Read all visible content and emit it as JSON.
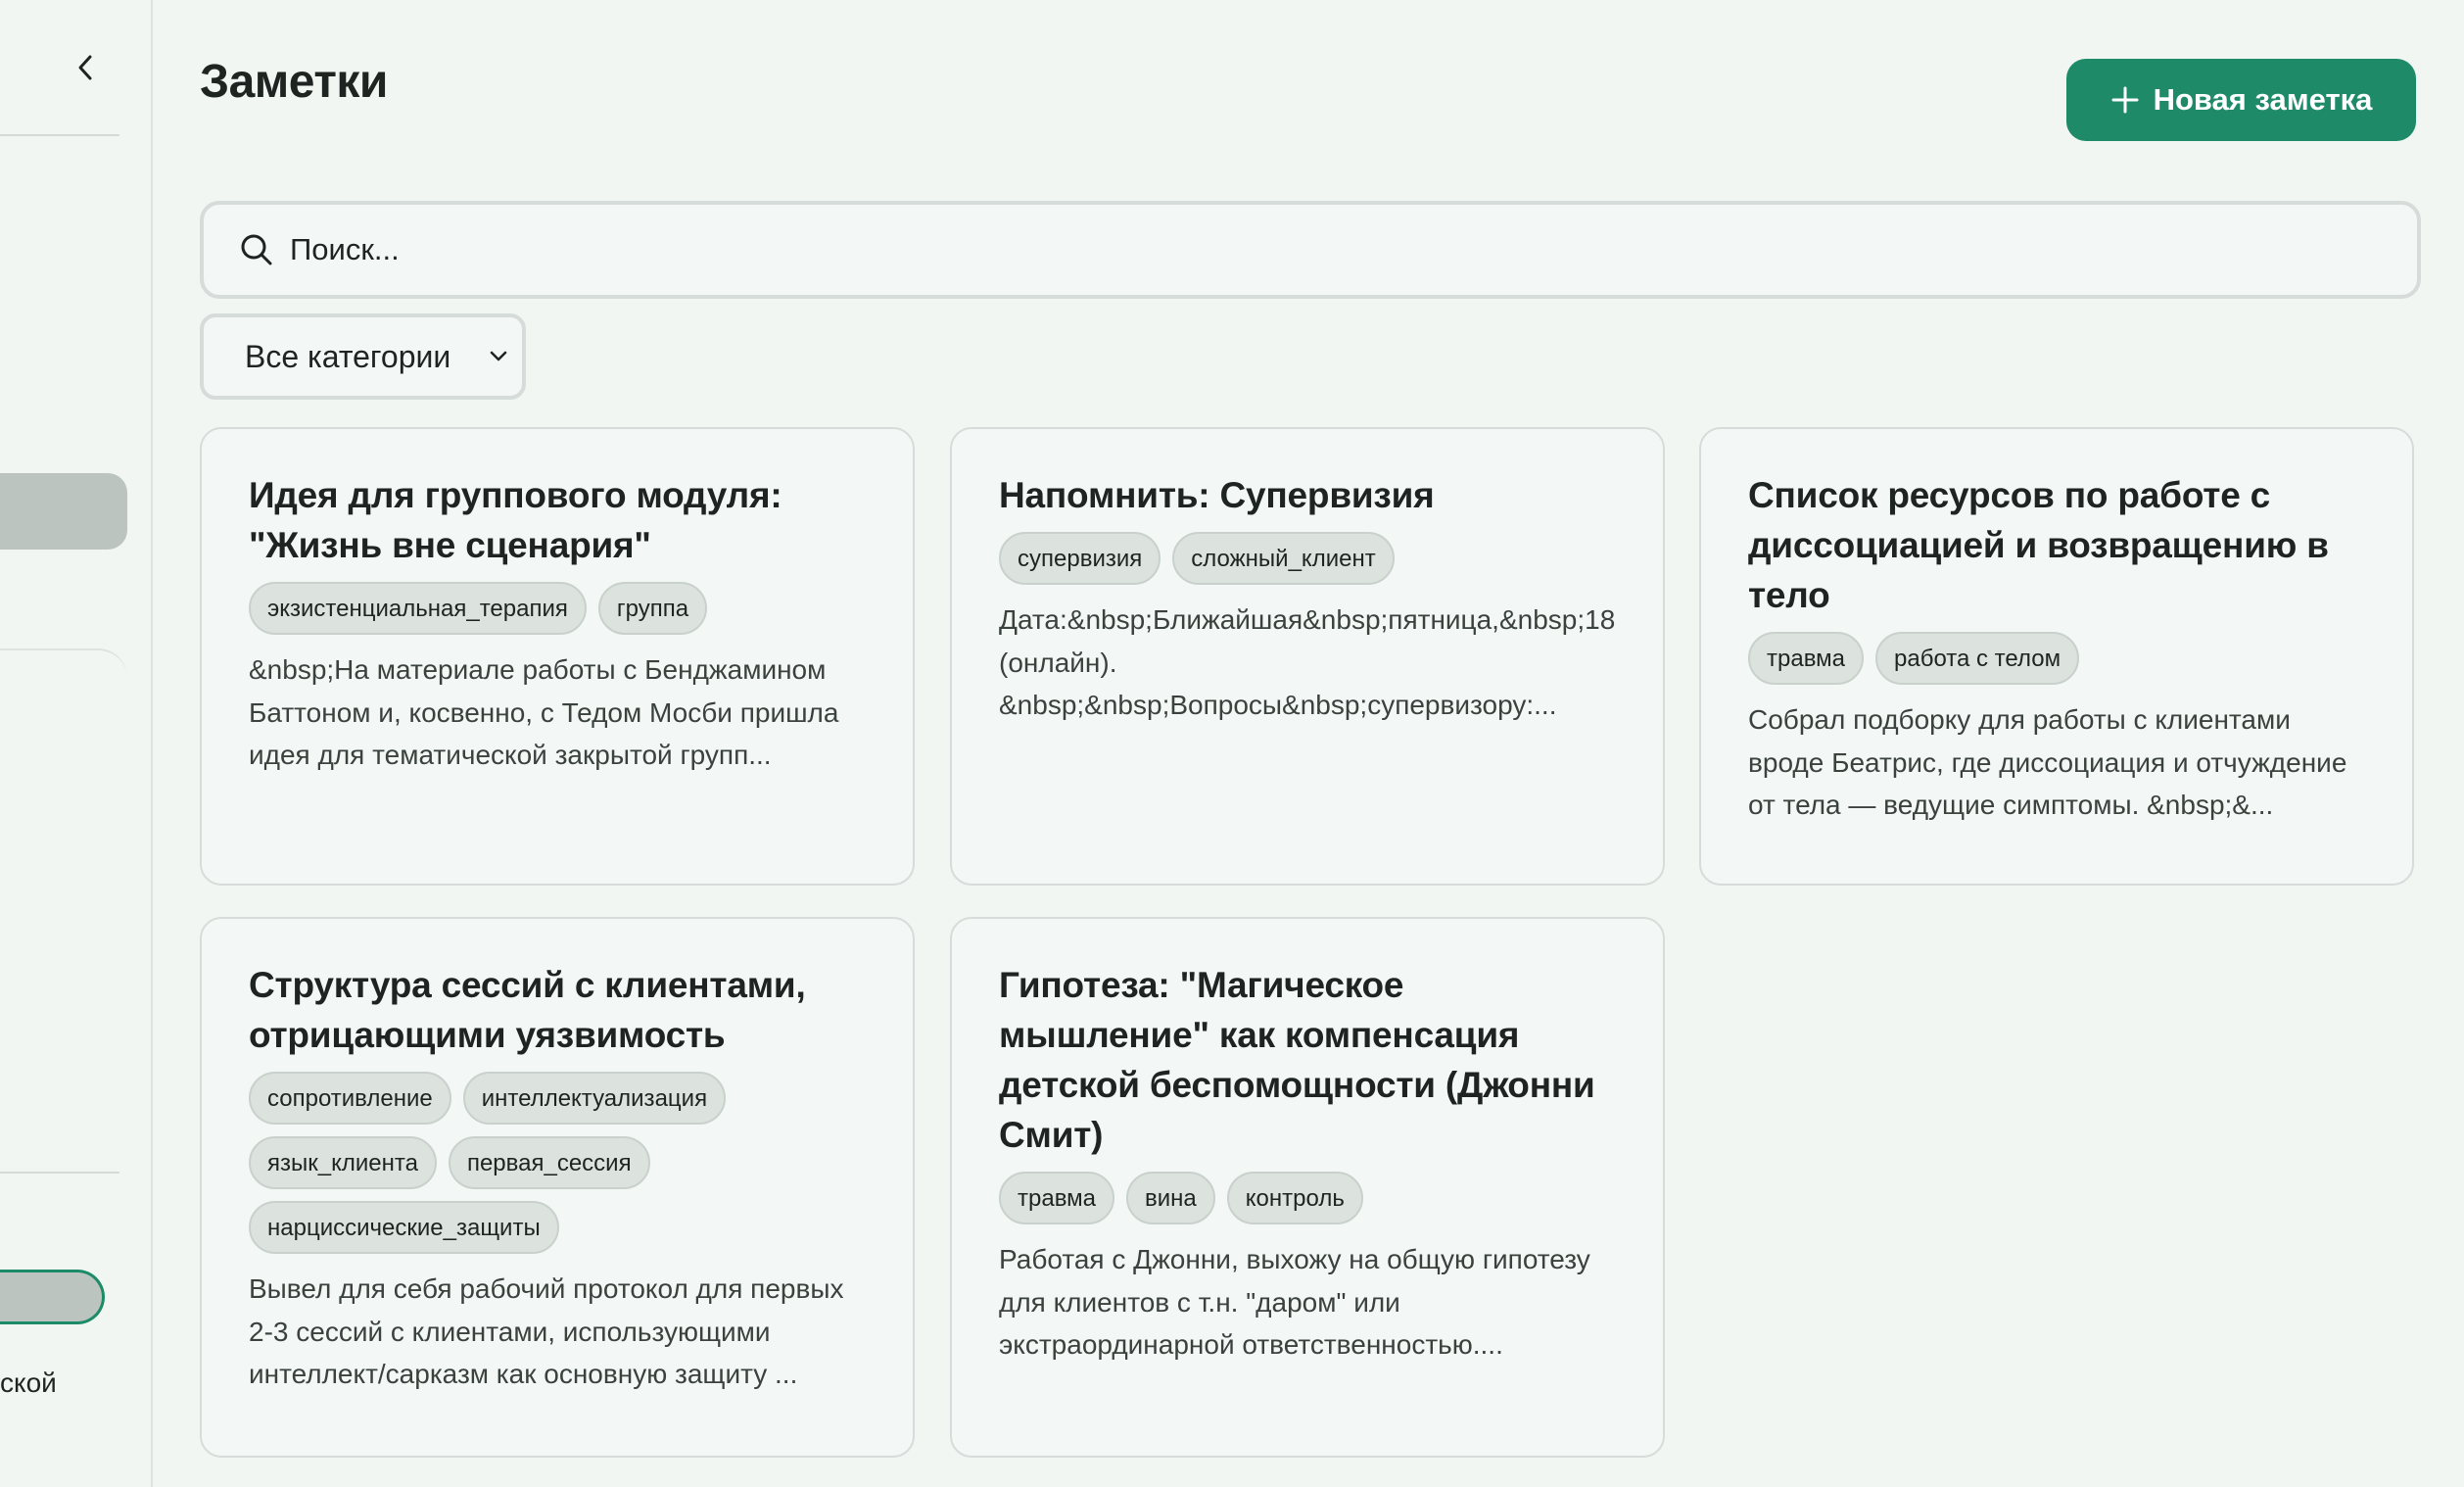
{
  "sidebar": {
    "partial_text": "ской"
  },
  "header": {
    "title": "Заметки",
    "new_note_label": "Новая заметка"
  },
  "search": {
    "placeholder": "Поиск..."
  },
  "filter": {
    "selected": "Все категории"
  },
  "colors": {
    "accent": "#1e8a68",
    "background": "#f1f6f3",
    "tag_bg": "#dce3df"
  },
  "notes": [
    {
      "title": "Идея для группового модуля: \"Жизнь вне сценария\"",
      "tags": [
        "экзистенциальная_терапия",
        "группа"
      ],
      "excerpt": "&nbsp;На материале работы с Бенджамином Баттоном и, косвенно, с Тедом Мосби пришла идея для тематической закрытой групп..."
    },
    {
      "title": "Напомнить: Супервизия",
      "tags": [
        "супервизия",
        "сложный_клиент"
      ],
      "excerpt": "Дата:&nbsp;Ближайшая&nbsp;пятница,&nbsp;18\n(онлайн).\n&nbsp;&nbsp;Вопросы&nbsp;супервизору:..."
    },
    {
      "title": "Список ресурсов по работе с диссоциацией и возвращению в тело",
      "tags": [
        "травма",
        "работа с телом"
      ],
      "excerpt": "Собрал подборку для работы с клиентами вроде Беатрис, где диссоциация и отчуждение от тела — ведущие симптомы. &nbsp;&..."
    },
    {
      "title": "Структура сессий с клиентами, отрицающими уязвимость",
      "tags": [
        "сопротивление",
        "интеллектуализация",
        "язык_клиента",
        "первая_сессия",
        "нарциссические_защиты"
      ],
      "excerpt": "Вывел для себя рабочий протокол для первых 2-3 сессий с клиентами, использующими интеллект/сарказм как основную защиту ..."
    },
    {
      "title": "Гипотеза: \"Магическое мышление\" как компенсация детской беспомощности (Джонни Смит)",
      "tags": [
        "травма",
        "вина",
        "контроль"
      ],
      "excerpt": "Работая с Джонни, выхожу на общую гипотезу для клиентов с т.н. \"даром\" или экстраординарной ответственностью...."
    }
  ]
}
